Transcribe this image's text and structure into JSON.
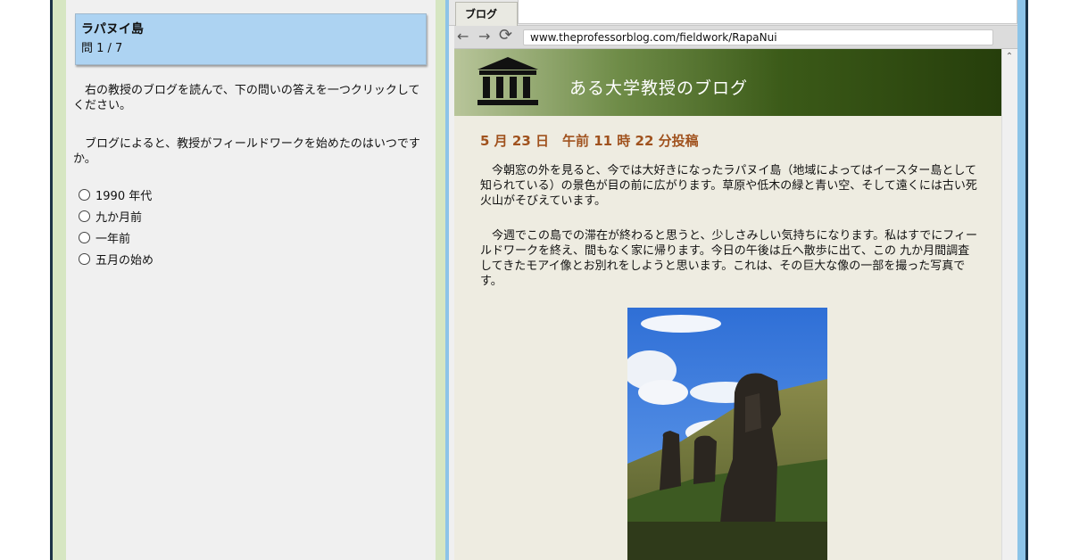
{
  "question_panel": {
    "title": "ラパヌイ島",
    "counter": "問 1 / 7",
    "instruction": "右の教授のブログを読んで、下の問いの答えを一つクリックしてください。",
    "question": "ブログによると、教授がフィールドワークを始めたのはいつですか。",
    "options": [
      "1990 年代",
      "九か月前",
      "一年前",
      "五月の始め"
    ]
  },
  "browser": {
    "tab_label": "ブログ",
    "back_icon": "back-arrow-icon",
    "forward_icon": "forward-arrow-icon",
    "reload_icon": "reload-icon",
    "url": "www.theprofessorblog.com/fieldwork/RapaNui"
  },
  "blog": {
    "icon": "museum-building-icon",
    "name": "ある大学教授のブログ",
    "post_date": "5 月 23 日　午前 11 時 22 分投稿",
    "paragraphs": [
      "今朝窓の外を見ると、今では大好きになったラパヌイ島（地域によってはイースター島として知られている）の景色が目の前に広がります。草原や低木の緑と青い空、そして遠くには古い死火山がそびえています。",
      "今週でこの島での滞在が終わると思うと、少しさみしい気持ちになります。私はすでにフィールドワークを終え、間もなく家に帰ります。今日の午後は丘へ散歩に出て、この 九か月間調査してきたモアイ像とお別れをしようと思います。これは、その巨大な像の一部を撮った写真です。"
    ],
    "photo": "moai-statues-photo"
  },
  "colors": {
    "accent_header": "#add3f2",
    "banner_dark": "#263e0b",
    "date_color": "#a0521e",
    "page_bg": "#eeece1"
  }
}
